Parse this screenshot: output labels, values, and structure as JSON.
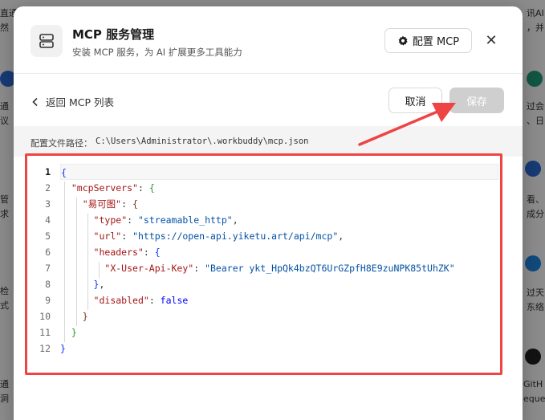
{
  "modal": {
    "title": "MCP 服务管理",
    "subtitle": "安装 MCP 服务，为 AI 扩展更多工具能力",
    "config_button": "配置 MCP",
    "close_glyph": "✕"
  },
  "toolbar": {
    "back_label": "返回 MCP 列表",
    "cancel_label": "取消",
    "save_label": "保存"
  },
  "config_path": {
    "label": "配置文件路径：",
    "value": "C:\\Users\\Administrator\\.workbuddy\\mcp.json"
  },
  "editor": {
    "line_numbers": [
      "1",
      "2",
      "3",
      "4",
      "5",
      "6",
      "7",
      "8",
      "9",
      "10",
      "11",
      "12"
    ],
    "active_line": 1,
    "json_keys": {
      "root": "mcpServers",
      "server": "易可图",
      "type_key": "type",
      "url_key": "url",
      "headers_key": "headers",
      "api_key_header": "X-User-Api-Key",
      "disabled_key": "disabled"
    },
    "json_values": {
      "type": "streamable_http",
      "url": "https://open-api.yiketu.art/api/mcp",
      "api_key": "Bearer ykt_HpQk4bzQT6UrGZpfH8E9zuNPK85tUhZK",
      "disabled": "false"
    }
  },
  "background_fragments": [
    "直通",
    "然",
    "讯AI",
    "，并",
    "通",
    "议",
    "过会",
    "、日",
    "管",
    "求",
    "看、",
    "成分",
    "检",
    "式",
    "过天",
    "东络",
    "通",
    "洞",
    "GitH",
    "eques"
  ],
  "colors": {
    "annotation_red": "#ef4444",
    "save_disabled": "#cfcfcf"
  }
}
